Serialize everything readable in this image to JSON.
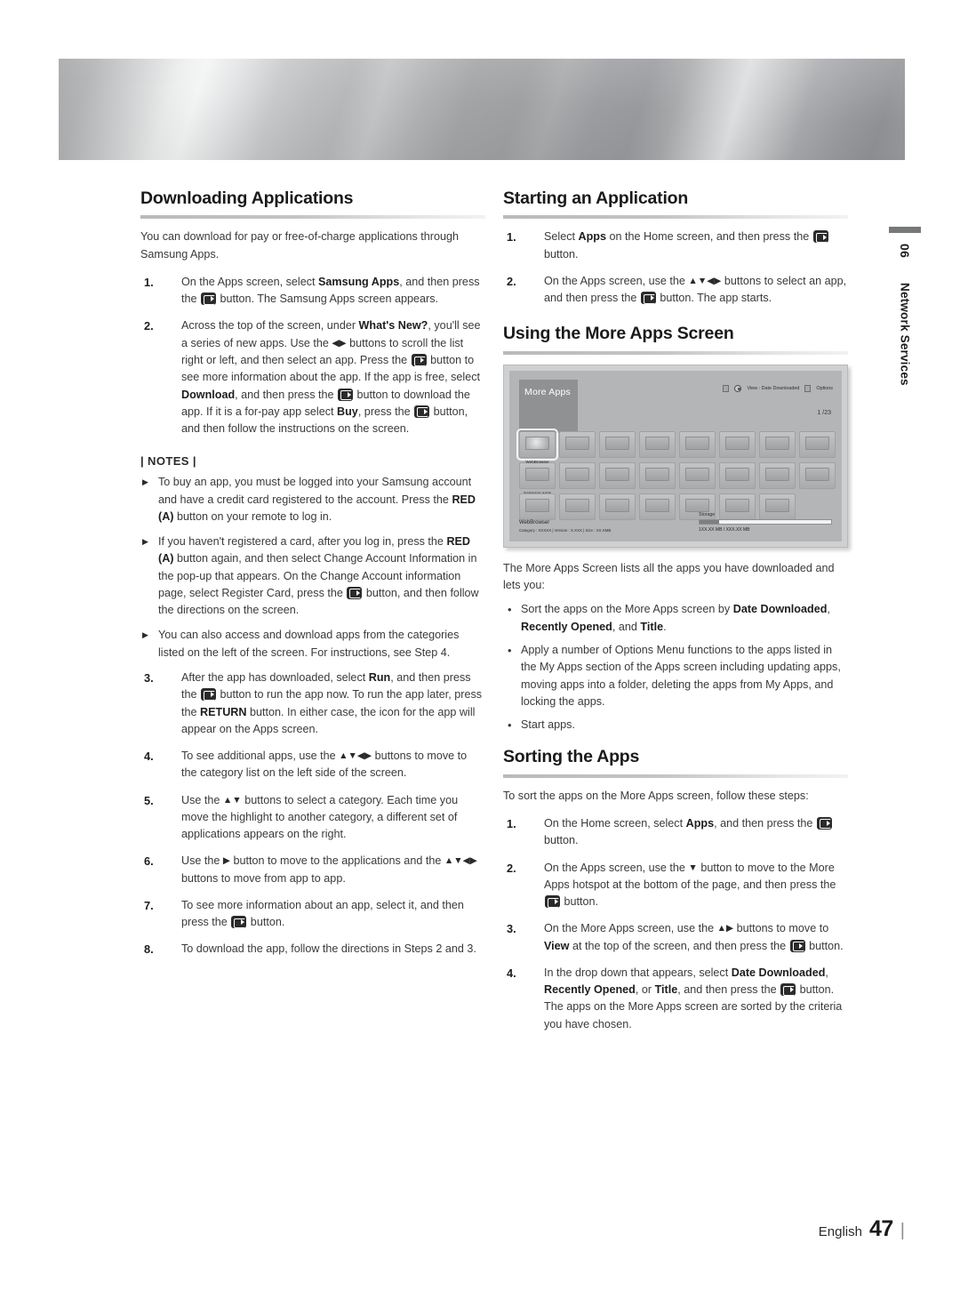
{
  "sidetab": {
    "number": "06",
    "title": "Network Services"
  },
  "footer": {
    "language": "English",
    "page": "47",
    "divider": "|"
  },
  "left": {
    "heading": "Downloading Applications",
    "intro": "You can download for pay or free-of-charge applications through Samsung Apps.",
    "steps": [
      {
        "num": "1.",
        "parts": [
          {
            "t": "On the Apps screen, select "
          },
          {
            "b": "Samsung Apps"
          },
          {
            "t": ", and then press the "
          },
          {
            "icon": "enter-button"
          },
          {
            "t": " button. The Samsung Apps screen appears."
          }
        ]
      },
      {
        "num": "2.",
        "parts": [
          {
            "t": "Across the top of the screen, under "
          },
          {
            "b": "What's New?"
          },
          {
            "t": ", you'll see a series of new apps. Use the "
          },
          {
            "arrow": "◀▶"
          },
          {
            "t": " buttons to scroll the list right or left, and then select an app. Press the "
          },
          {
            "icon": "enter-button"
          },
          {
            "t": " button to see more information about the app. If the app is free, select "
          },
          {
            "b": "Download"
          },
          {
            "t": ", and then press the "
          },
          {
            "icon": "enter-button"
          },
          {
            "t": " button to download the app. If it is a for-pay app select "
          },
          {
            "b": "Buy"
          },
          {
            "t": ", press the "
          },
          {
            "icon": "enter-button"
          },
          {
            "t": " button, and then follow the instructions on the screen."
          }
        ]
      }
    ],
    "notes_heading": "| NOTES |",
    "notes": [
      [
        {
          "t": "To buy an app, you must be logged into your Samsung account and have a credit card registered to the account. Press the "
        },
        {
          "b": "RED (A)"
        },
        {
          "t": " button on your remote to log in."
        }
      ],
      [
        {
          "t": "If you haven't registered a card, after you log in, press the "
        },
        {
          "b": "RED (A)"
        },
        {
          "t": " button again, and then select Change Account Information in the pop-up that appears. On the Change Account information page, select Register Card, press the "
        },
        {
          "icon": "enter-button"
        },
        {
          "t": " button, and then follow the directions on the screen."
        }
      ],
      [
        {
          "t": "You can also access and download apps from the categories listed on the left of the screen. For instructions, see Step 4."
        }
      ]
    ],
    "steps2": [
      {
        "num": "3.",
        "parts": [
          {
            "t": "After the app has downloaded, select "
          },
          {
            "b": "Run"
          },
          {
            "t": ", and then press the "
          },
          {
            "icon": "enter-button"
          },
          {
            "t": " button to run the app now. To run the app later, press the "
          },
          {
            "b": "RETURN"
          },
          {
            "t": " button. In either case, the icon for the app will appear on the Apps screen."
          }
        ]
      },
      {
        "num": "4.",
        "parts": [
          {
            "t": "To see additional apps, use the "
          },
          {
            "arrow": "▲▼◀▶"
          },
          {
            "t": " buttons to move to the category list on the left side of the screen."
          }
        ]
      },
      {
        "num": "5.",
        "parts": [
          {
            "t": "Use the "
          },
          {
            "arrow": "▲▼"
          },
          {
            "t": " buttons to select a category. Each time you move the highlight to another category, a different set of applications appears on the right."
          }
        ]
      },
      {
        "num": "6.",
        "parts": [
          {
            "t": "Use the "
          },
          {
            "arrow": "▶"
          },
          {
            "t": " button to move to the applications and the "
          },
          {
            "arrow": "▲▼◀▶"
          },
          {
            "t": " buttons to move from app to app."
          }
        ]
      },
      {
        "num": "7.",
        "parts": [
          {
            "t": "To see more information about an app, select it, and then press the "
          },
          {
            "icon": "enter-button"
          },
          {
            "t": " button."
          }
        ]
      },
      {
        "num": "8.",
        "parts": [
          {
            "t": "To download the app, follow the directions in Steps 2 and 3."
          }
        ]
      }
    ]
  },
  "right": {
    "heading1": "Starting an Application",
    "steps1": [
      {
        "num": "1.",
        "parts": [
          {
            "t": "Select "
          },
          {
            "b": "Apps"
          },
          {
            "t": " on the Home screen, and then press the "
          },
          {
            "icon": "enter-button"
          },
          {
            "t": " button."
          }
        ]
      },
      {
        "num": "2.",
        "parts": [
          {
            "t": "On the Apps screen, use the "
          },
          {
            "arrow": "▲▼◀▶"
          },
          {
            "t": " buttons to select an app, and then press the "
          },
          {
            "icon": "enter-button"
          },
          {
            "t": " button. The app starts."
          }
        ]
      }
    ],
    "heading2": "Using the More Apps Screen",
    "figure": {
      "title": "More Apps",
      "view_label": "View : Date Downloaded",
      "options_label": "Options",
      "page_indicator": "1 /23",
      "selected_app": "WebBrowser",
      "second_app": "Samsung Apps",
      "footer_name": "WebBrowser",
      "footer_meta": "Category : XXXXX  |  Version : X.XXX  |  Size : XX.XMB",
      "storage_label": "Storage",
      "storage_value": "1XX.XX MB / XXX.XX MB",
      "storage_percent": 15,
      "rows": [
        8,
        8,
        7
      ]
    },
    "intro2": "The More Apps Screen lists all the apps you have downloaded and lets you:",
    "bullets": [
      [
        {
          "t": "Sort the apps on the More Apps screen by "
        },
        {
          "b": "Date Downloaded"
        },
        {
          "t": ", "
        },
        {
          "b": "Recently Opened"
        },
        {
          "t": ", and "
        },
        {
          "b": "Title"
        },
        {
          "t": "."
        }
      ],
      [
        {
          "t": "Apply a number of Options Menu functions to the apps listed in the My Apps section of the Apps screen including updating apps, moving apps into a folder, deleting the apps from My Apps, and locking the apps."
        }
      ],
      [
        {
          "t": "Start apps."
        }
      ]
    ],
    "heading3": "Sorting the Apps",
    "intro3": "To sort the apps on the More Apps screen, follow these steps:",
    "steps3": [
      {
        "num": "1.",
        "parts": [
          {
            "t": "On the Home screen, select "
          },
          {
            "b": "Apps"
          },
          {
            "t": ", and then press the "
          },
          {
            "icon": "enter-button"
          },
          {
            "t": " button."
          }
        ]
      },
      {
        "num": "2.",
        "parts": [
          {
            "t": "On the Apps screen, use the "
          },
          {
            "arrow": "▼"
          },
          {
            "t": " button to move to the More Apps hotspot at the bottom of the page, and then press the "
          },
          {
            "icon": "enter-button"
          },
          {
            "t": " button."
          }
        ]
      },
      {
        "num": "3.",
        "parts": [
          {
            "t": "On the More Apps screen, use the "
          },
          {
            "arrow": "▲▶"
          },
          {
            "t": " buttons to move to "
          },
          {
            "b": "View"
          },
          {
            "t": " at the top of the screen, and then press the "
          },
          {
            "icon": "enter-button"
          },
          {
            "t": " button."
          }
        ]
      },
      {
        "num": "4.",
        "parts": [
          {
            "t": "In the drop down that appears, select "
          },
          {
            "b": "Date Downloaded"
          },
          {
            "t": ", "
          },
          {
            "b": "Recently Opened"
          },
          {
            "t": ", or "
          },
          {
            "b": "Title"
          },
          {
            "t": ", and then press the "
          },
          {
            "icon": "enter-button"
          },
          {
            "t": " button. The apps on the More Apps screen are sorted by the criteria you have chosen."
          }
        ]
      }
    ]
  }
}
